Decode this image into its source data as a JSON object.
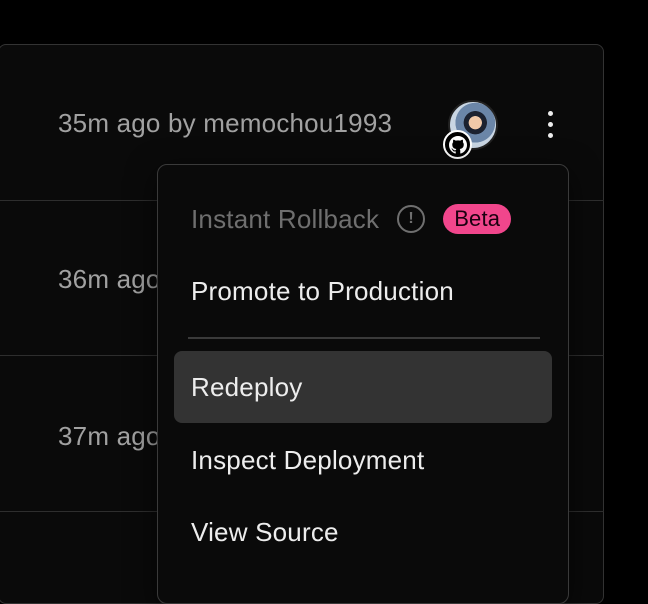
{
  "deployments": [
    {
      "time": "35m ago",
      "by": "by",
      "user": "memochou1993",
      "meta": "35m ago by memochou1993"
    },
    {
      "meta": "36m ago"
    },
    {
      "meta": "37m ago"
    }
  ],
  "icons": {
    "avatar": "user-avatar",
    "badge": "github-icon",
    "more": "vertical-ellipsis-icon",
    "info": "info-icon"
  },
  "menu": {
    "instant_rollback": "Instant Rollback",
    "beta_badge": "Beta",
    "promote": "Promote to Production",
    "redeploy": "Redeploy",
    "inspect": "Inspect Deployment",
    "view_source": "View Source"
  },
  "colors": {
    "background": "#000000",
    "menu_highlight": "#333333",
    "beta_badge": "#f1468c",
    "muted_text": "#a1a1a1"
  }
}
